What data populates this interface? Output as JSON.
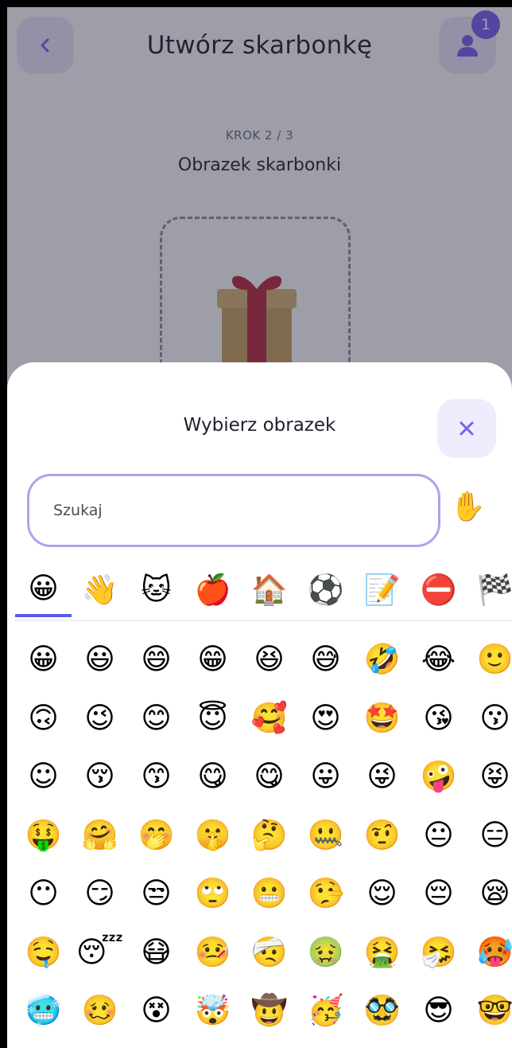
{
  "header": {
    "title": "Utwórz skarbonkę",
    "back_icon": "chevron-left-icon",
    "profile_icon": "user-icon",
    "notification_count": "1"
  },
  "step": {
    "label": "KROK 2 / 3",
    "title": "Obrazek skarbonki",
    "selected_image_icon": "gift-icon"
  },
  "picker": {
    "title": "Wybierz obrazek",
    "close_icon": "close-icon",
    "search_placeholder": "Szukaj",
    "skin_tone_emoji": "✋",
    "categories": [
      "😀",
      "👋",
      "🐱",
      "🍎",
      "🏠",
      "⚽",
      "📝",
      "⛔",
      "🏁"
    ],
    "active_category": 0,
    "emojis": [
      [
        "😀",
        "😃",
        "😄",
        "😁",
        "😆",
        "😅",
        "🤣",
        "😂",
        "🙂"
      ],
      [
        "🙃",
        "😉",
        "😊",
        "😇",
        "🥰",
        "😍",
        "🤩",
        "😘",
        "😗"
      ],
      [
        "☺",
        "😚",
        "😙",
        "😋",
        "😋",
        "😛",
        "😜",
        "🤪",
        "😝"
      ],
      [
        "🤑",
        "🤗",
        "🤭",
        "🤫",
        "🤔",
        "🤐",
        "🤨",
        "😐",
        "😑"
      ],
      [
        "😶",
        "😏",
        "😒",
        "🙄",
        "😬",
        "🤥",
        "😌",
        "😔",
        "😪"
      ],
      [
        "🤤",
        "😴",
        "😷",
        "🤒",
        "🤕",
        "🤢",
        "🤮",
        "🤧",
        "🥵"
      ],
      [
        "🥶",
        "🥴",
        "😵",
        "🤯",
        "🤠",
        "🥳",
        "🥸",
        "😎",
        "🤓"
      ],
      [
        "🧐",
        "😕",
        "😟",
        "🙁",
        "☹",
        "😮",
        "😯",
        "😲",
        "😳"
      ]
    ]
  },
  "colors": {
    "accent": "#7c5df0",
    "tab_indicator": "#5b5be8",
    "search_border": "#a7a5ee",
    "button_bg": "#ece8fb"
  }
}
